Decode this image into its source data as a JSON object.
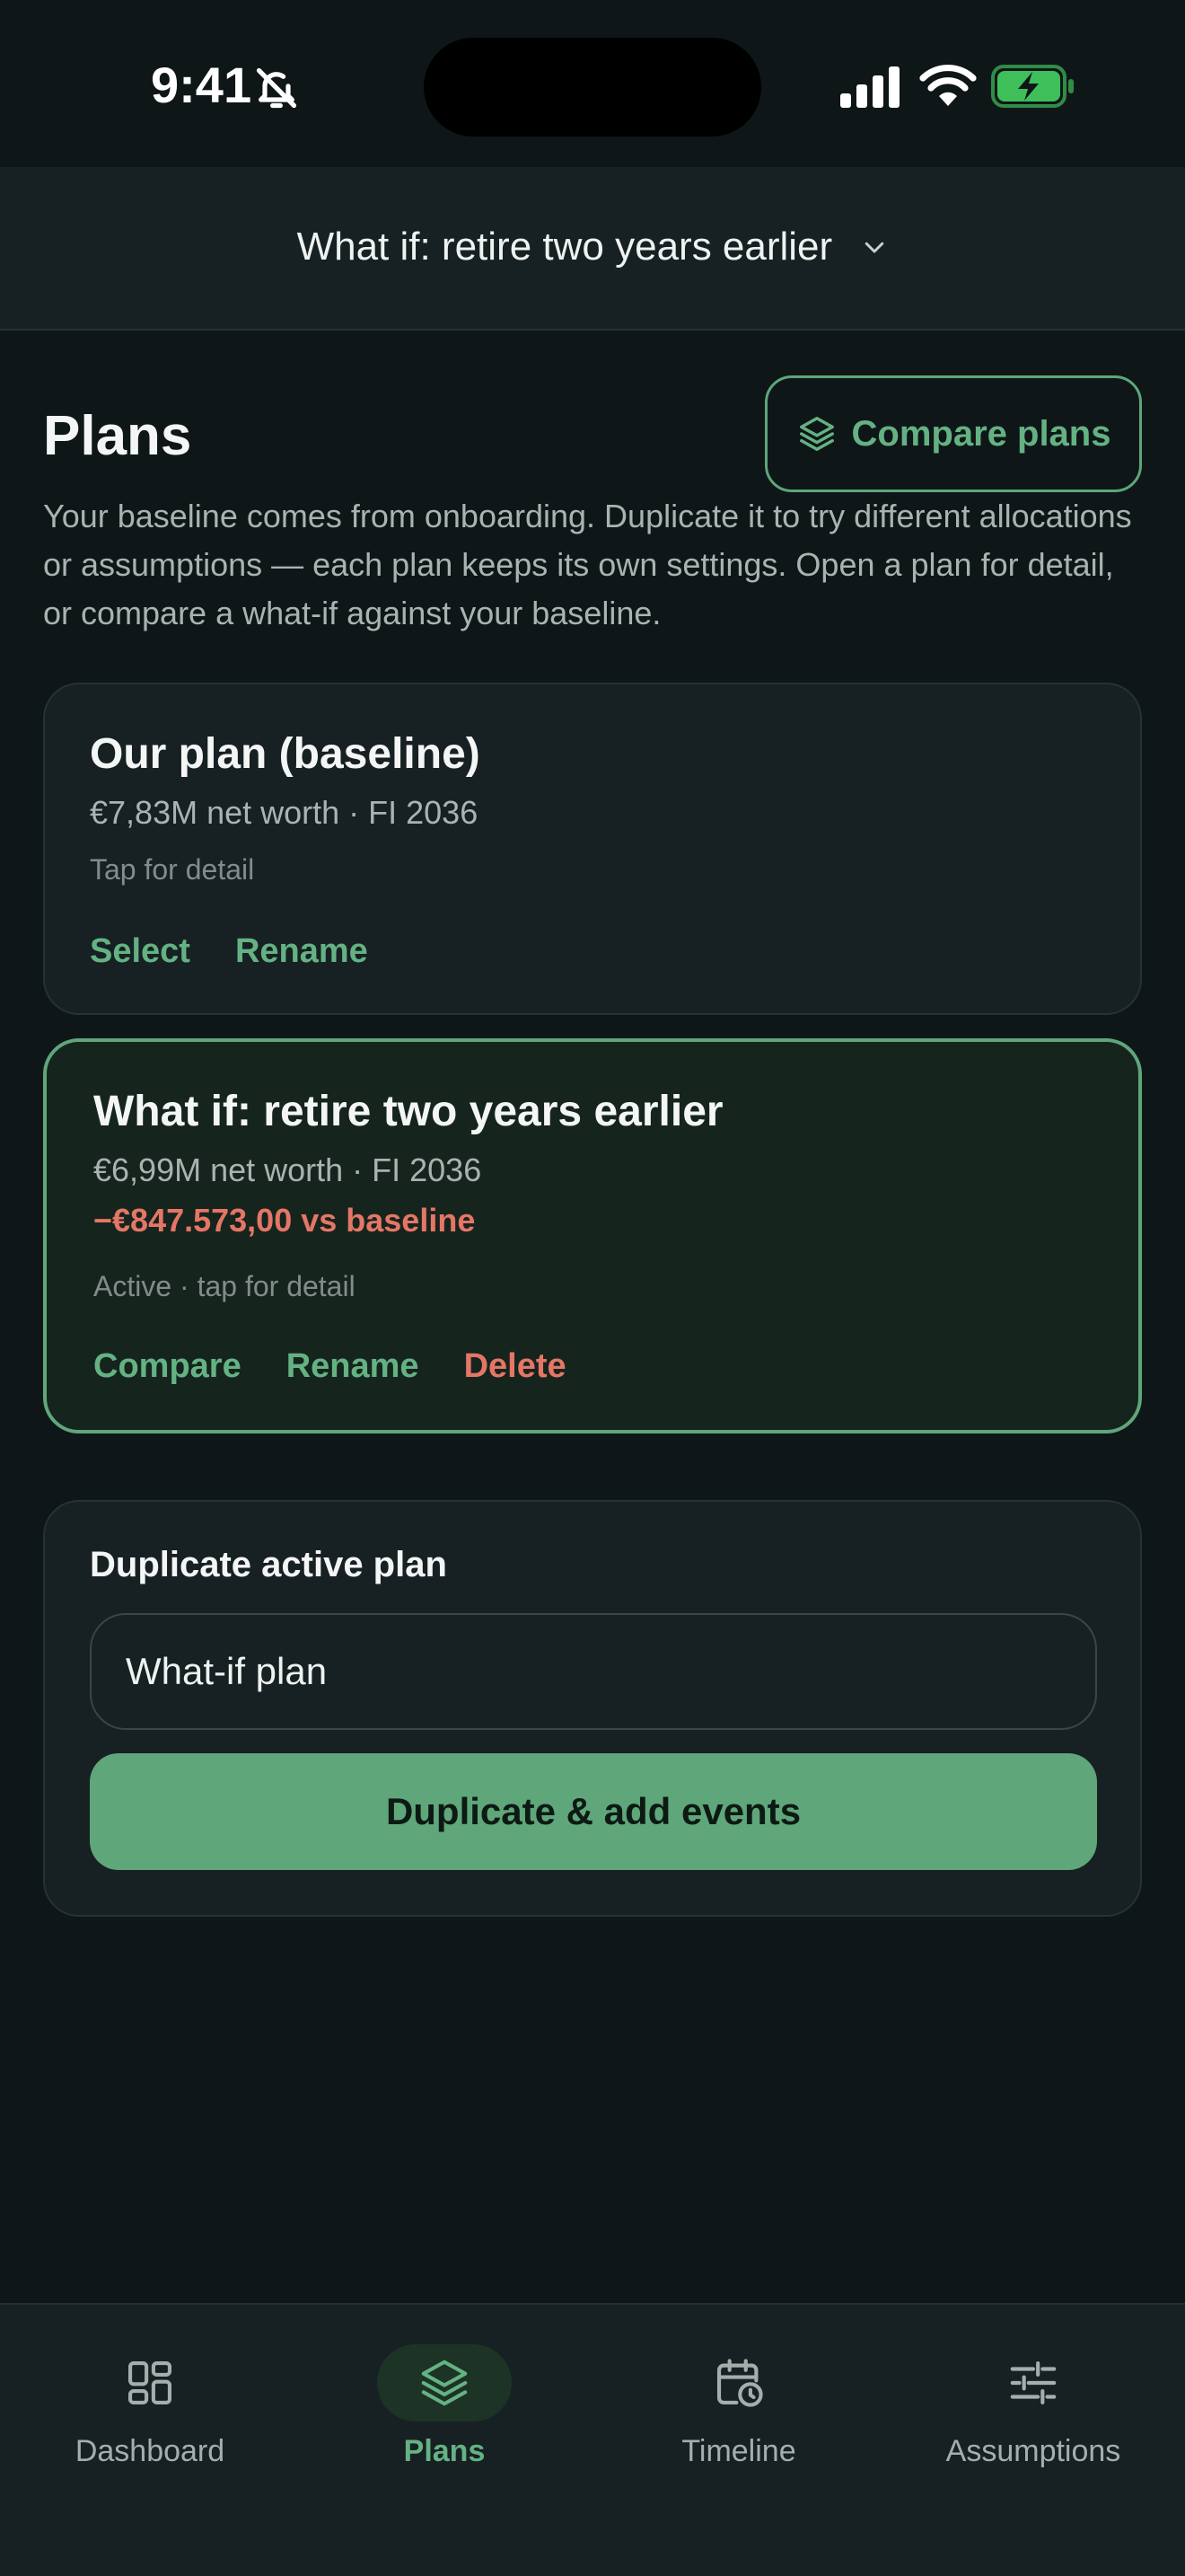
{
  "status_bar": {
    "time": "9:41",
    "icons": [
      "bell-slash-icon",
      "signal-icon",
      "wifi-icon",
      "battery-charging-icon"
    ]
  },
  "header": {
    "title": "What if: retire two years earlier",
    "icon": "chevron-down-icon"
  },
  "page": {
    "title": "Plans",
    "compare_button": "Compare plans",
    "compare_icon": "layers-icon",
    "intro": "Your baseline comes from onboarding. Duplicate it to try different allocations or assumptions — each plan keeps its own settings. Open a plan for detail, or compare a what-if against your baseline."
  },
  "plans": [
    {
      "name": "Our plan (baseline)",
      "meta": "€7,83M net worth · FI 2036",
      "hint": "Tap for detail",
      "actions": [
        "Select",
        "Rename"
      ]
    },
    {
      "name": "What if: retire two years earlier",
      "meta": "€6,99M net worth · FI 2036",
      "delta": "−€847.573,00 vs baseline",
      "hint": "Active · tap for detail",
      "actions": [
        "Compare",
        "Rename",
        "Delete"
      ]
    }
  ],
  "duplicate": {
    "title": "Duplicate active plan",
    "input_value": "What-if plan",
    "button": "Duplicate & add events"
  },
  "tabs": [
    {
      "label": "Dashboard",
      "icon": "grid-icon"
    },
    {
      "label": "Plans",
      "icon": "layers-icon",
      "active": true
    },
    {
      "label": "Timeline",
      "icon": "calendar-clock-icon"
    },
    {
      "label": "Assumptions",
      "icon": "sliders-icon"
    }
  ],
  "colors": {
    "background": "#0f1618",
    "surface": "#172022",
    "accent": "#5fa67b",
    "danger": "#e57666"
  }
}
